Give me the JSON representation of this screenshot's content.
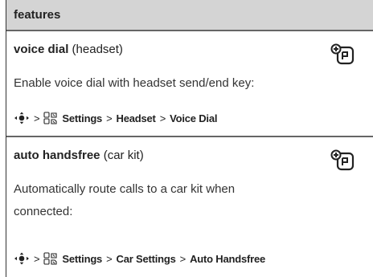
{
  "header": {
    "title": "features"
  },
  "rows": [
    {
      "title_bold": "voice dial",
      "title_rest": " (headset)",
      "description": "Enable voice dial with headset send/end key:",
      "path": [
        "Settings",
        "Headset",
        "Voice Dial"
      ]
    },
    {
      "title_bold": "auto handsfree",
      "title_rest": " (car kit)",
      "description_line1": "Automatically route calls to a car kit when",
      "description_line2": "connected:",
      "path": [
        "Settings",
        "Car Settings",
        "Auto Handsfree"
      ]
    }
  ],
  "separator": ">",
  "icons": {
    "nav": "nav-key-icon",
    "settings": "settings-icon",
    "accessory": "handset-plus-icon"
  }
}
